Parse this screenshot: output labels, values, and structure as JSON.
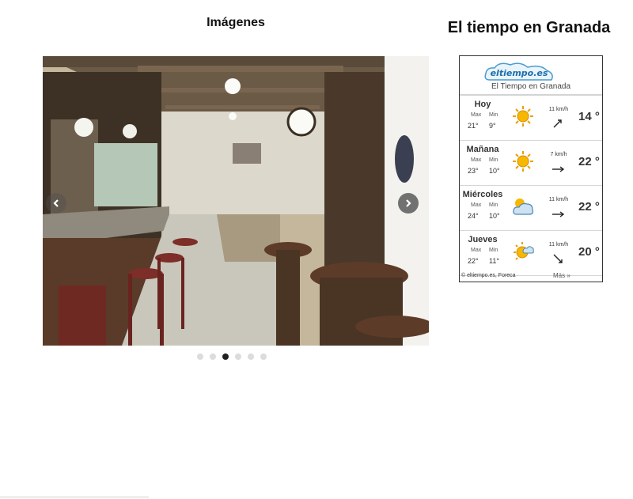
{
  "gallery": {
    "title": "Imágenes",
    "slide_count": 6,
    "active_slide": 3
  },
  "weather": {
    "title": "El tiempo en Granada",
    "logo_text": "eltiempo.es",
    "subtitle": "El Tiempo en Granada",
    "max_label": "Max",
    "min_label": "Min",
    "days": [
      {
        "name": "Hoy",
        "max": "21°",
        "min": "9°",
        "wind": "11 km/h",
        "temp": "14 °",
        "icon": "sun-icon"
      },
      {
        "name": "Mañana",
        "max": "23°",
        "min": "10°",
        "wind": "7 km/h",
        "temp": "22 °",
        "icon": "sun-icon"
      },
      {
        "name": "Miércoles",
        "max": "24°",
        "min": "10°",
        "wind": "11 km/h",
        "temp": "22 °",
        "icon": "cloud-sun-icon"
      },
      {
        "name": "Jueves",
        "max": "22°",
        "min": "11°",
        "wind": "11 km/h",
        "temp": "20 °",
        "icon": "sun-cloud-icon"
      }
    ],
    "credit": "© eltiempo.es, Foreca",
    "more_link": "Más »"
  }
}
